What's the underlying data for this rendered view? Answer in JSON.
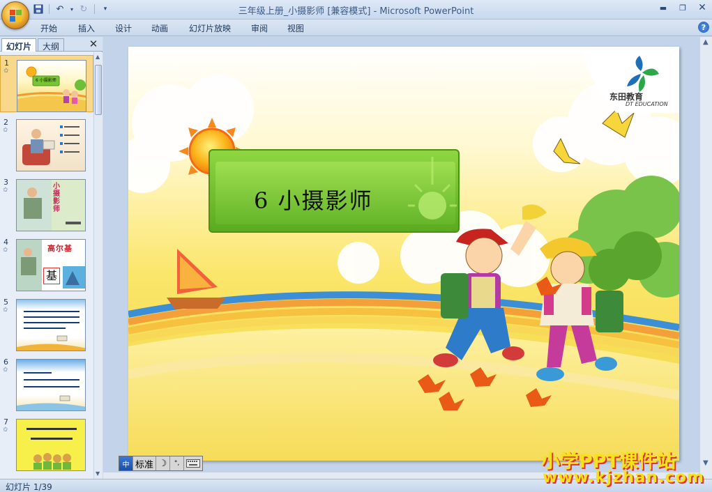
{
  "window": {
    "title": "三年级上册_小摄影师 [兼容模式] - Microsoft PowerPoint"
  },
  "ribbon": {
    "tabs": [
      "开始",
      "插入",
      "设计",
      "动画",
      "幻灯片放映",
      "审阅",
      "视图"
    ]
  },
  "left_panel": {
    "tabs": [
      "幻灯片",
      "大纲"
    ],
    "slides": [
      {
        "num": "1",
        "selected": true,
        "text": "6 小摄影师"
      },
      {
        "num": "2",
        "selected": false
      },
      {
        "num": "3",
        "selected": false,
        "text": "小摄影师"
      },
      {
        "num": "4",
        "selected": false,
        "text": "高尔基",
        "text2": "基"
      },
      {
        "num": "5",
        "selected": false
      },
      {
        "num": "6",
        "selected": false
      },
      {
        "num": "7",
        "selected": false
      }
    ]
  },
  "slide": {
    "title": "6  小摄影师",
    "brand_name": "东田教育",
    "brand_sub": "DT EDUCATION"
  },
  "ime_bar": {
    "mode": "标准"
  },
  "status": {
    "slide_counter": "幻灯片 1/39"
  },
  "watermark": {
    "line1": "小学PPT课件站",
    "line2": "www.kjzhan.com"
  }
}
